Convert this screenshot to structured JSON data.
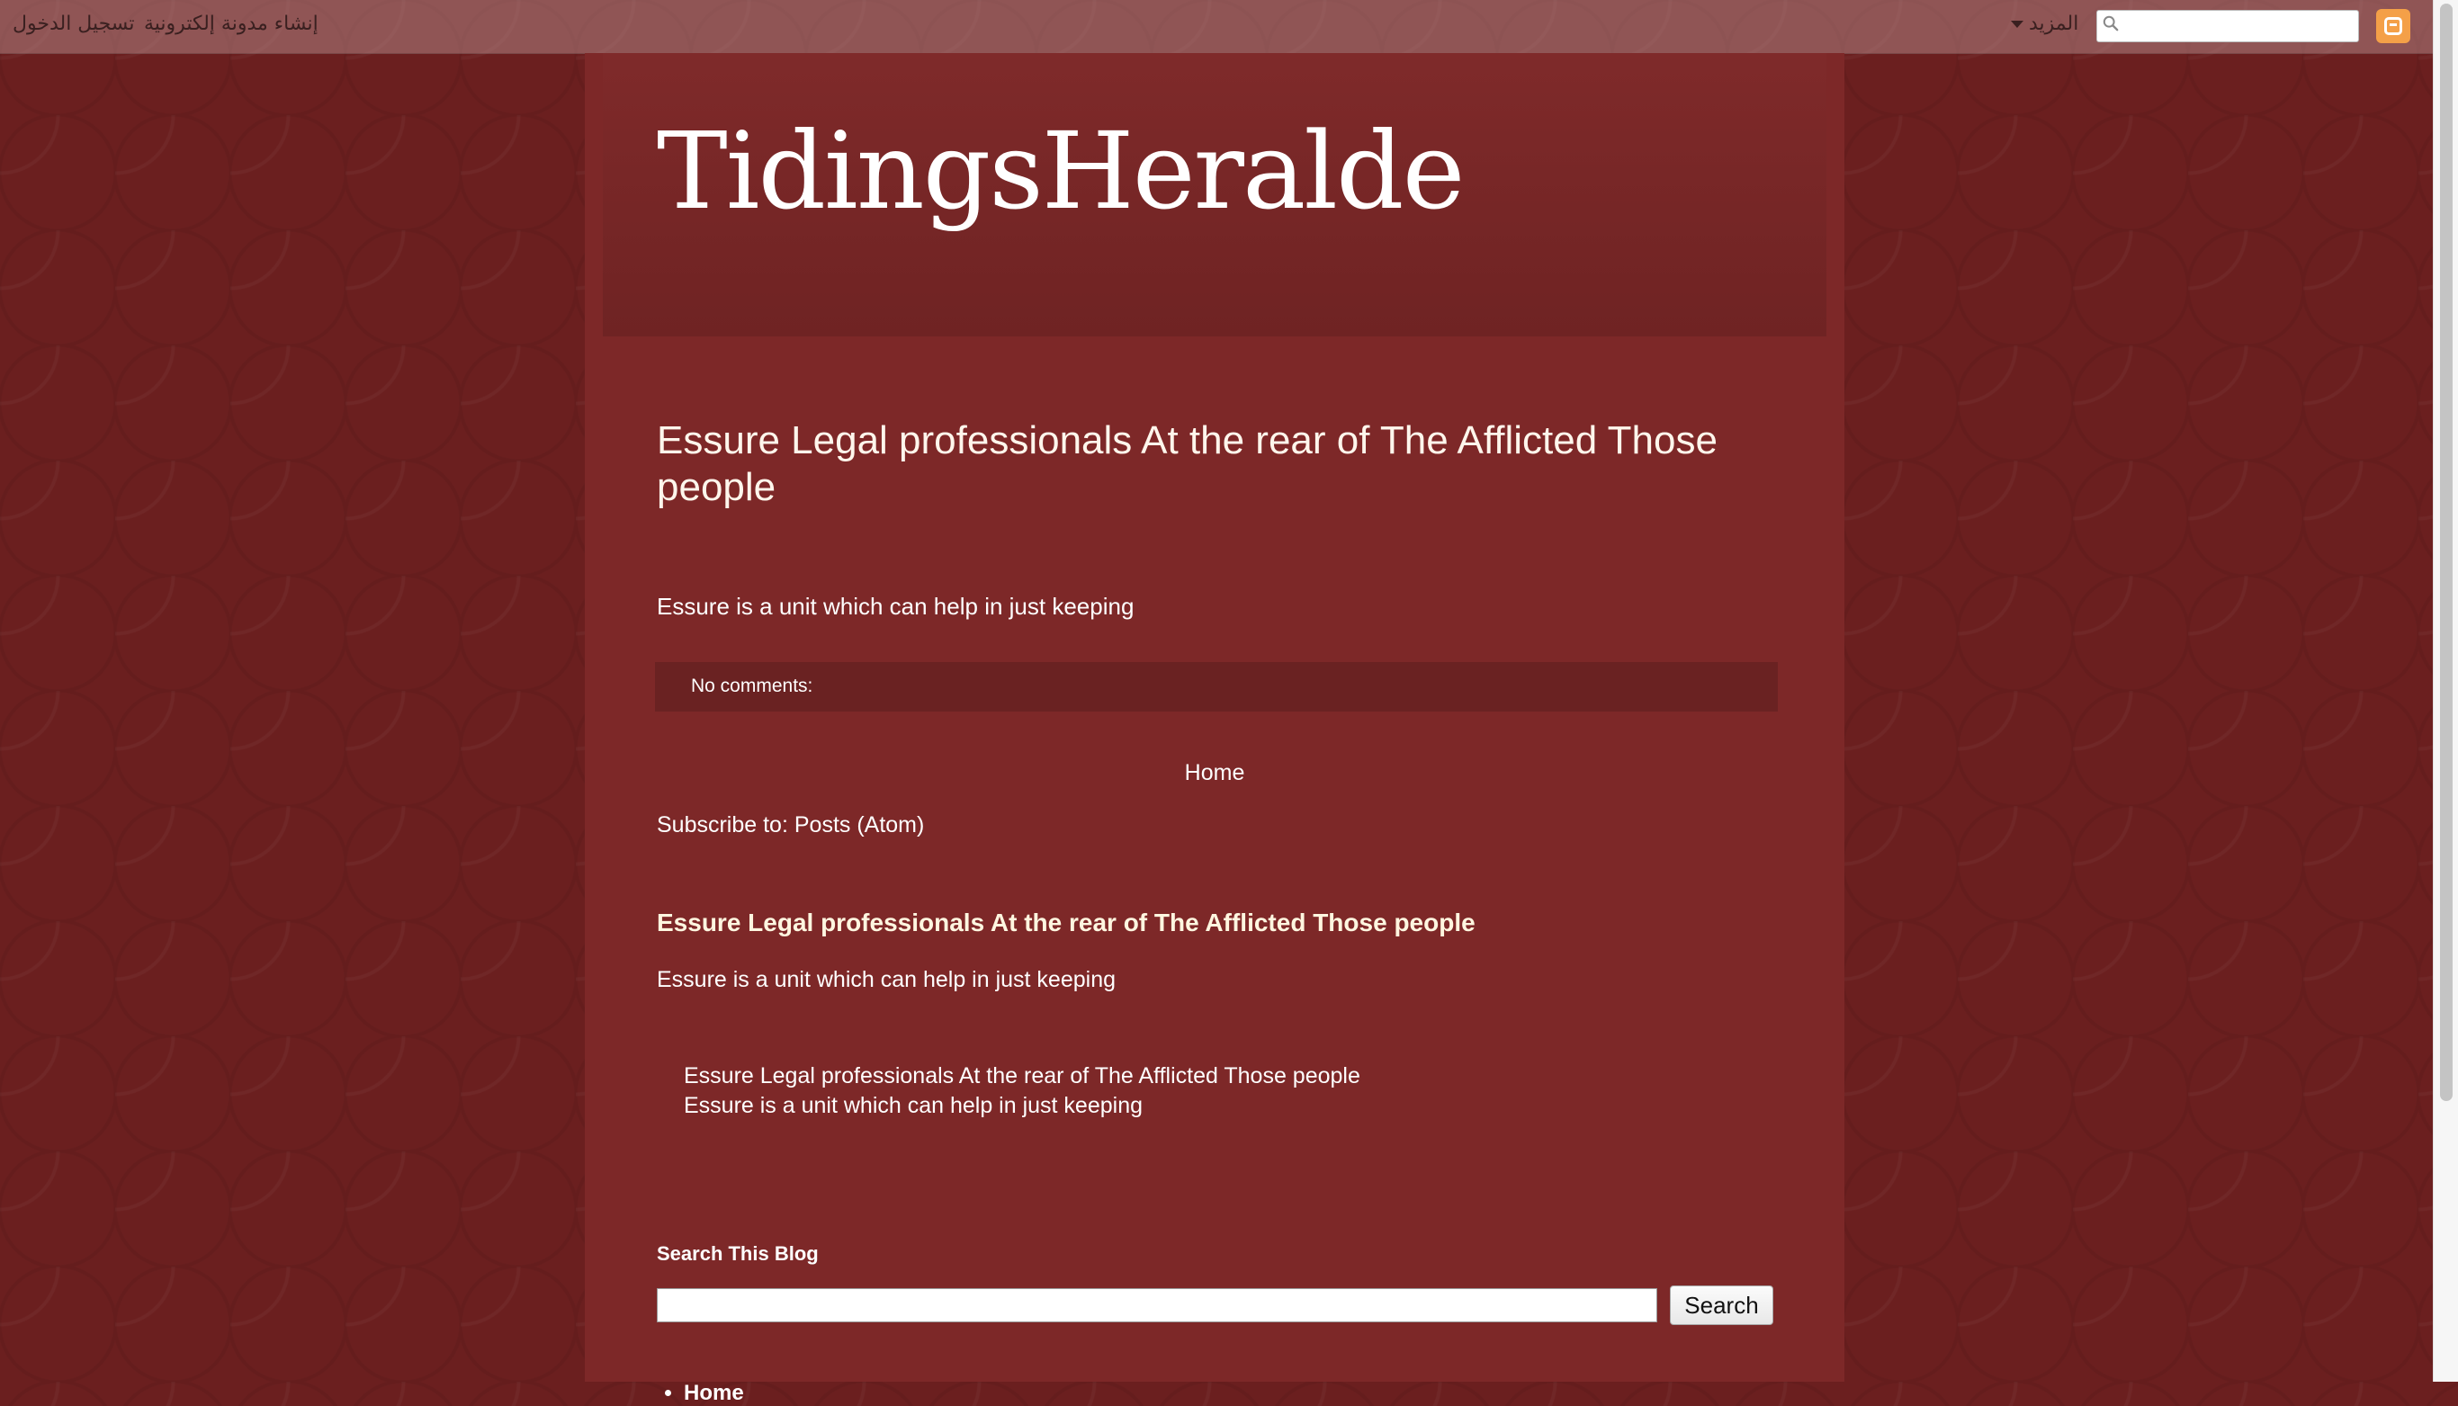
{
  "navbar": {
    "signin_label": "تسجيل الدخول",
    "create_blog_label": "إنشاء مدونة إلكترونية",
    "more_label": "المزيد",
    "search_placeholder": ""
  },
  "header": {
    "blog_title": "TidingsHeralde"
  },
  "post": {
    "title": "Essure Legal professionals At the rear of The Afflicted Those people",
    "body": "Essure is a unit which can help in just keeping",
    "comments_label": "No comments:"
  },
  "pager": {
    "home_label": "Home"
  },
  "subscribe": {
    "prefix": "Subscribe to: ",
    "link_label": "Posts (Atom)"
  },
  "popular_post": {
    "title": "Essure Legal professionals At the rear of The Afflicted Those people",
    "snippet": "Essure is a unit which can help in just keeping"
  },
  "featured_post": {
    "title": "Essure Legal professionals At the rear of The Afflicted Those people",
    "snippet": "Essure is a unit which can help in just keeping"
  },
  "search_widget": {
    "heading": "Search This Blog",
    "input_value": "",
    "button_label": "Search"
  },
  "pages": {
    "items": [
      "Home"
    ]
  },
  "colors": {
    "background": "#6b1f1f",
    "content": "#7d2828",
    "header_band": "#732525",
    "post_footer": "#6a2222",
    "blogger_orange": "#f4a048"
  }
}
